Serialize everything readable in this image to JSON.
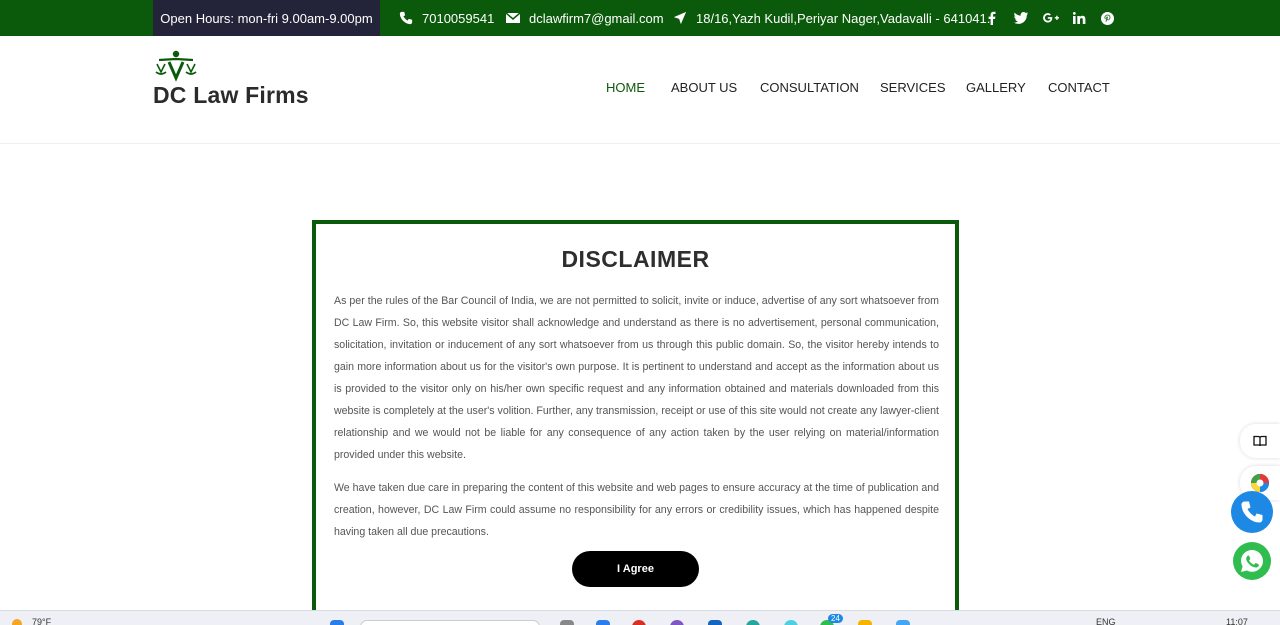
{
  "topbar": {
    "hours": "Open Hours: mon-fri 9.00am-9.00pm",
    "phone": "7010059541",
    "email": "dclawfirm7@gmail.com",
    "address": "18/16,Yazh Kudil,Periyar Nager,Vadavalli - 641041.",
    "social": [
      "f",
      "twitter",
      "G+",
      "in",
      "pinterest"
    ]
  },
  "brand": {
    "name": "DC Law Firms"
  },
  "nav": {
    "items": [
      "HOME",
      "ABOUT US",
      "CONSULTATION",
      "SERVICES",
      "GALLERY",
      "CONTACT"
    ],
    "active": "HOME"
  },
  "disclaimer": {
    "title": "DISCLAIMER",
    "paragraph1": "As per the rules of the Bar Council of India, we are not permitted to solicit, invite or induce, advertise of any sort whatsoever from DC Law Firm. So, this website visitor shall acknowledge and understand as there is no advertisement, personal communication, solicitation, invitation or inducement of any sort whatsoever from us through this public domain. So, the visitor hereby intends to gain more information about us for the visitor's own purpose. It is pertinent to understand and accept as the information about us is provided to the visitor only on his/her own specific request and any information obtained and materials downloaded from this website is completely at the user's volition. Further, any transmission, receipt or use of this site would not create any lawyer-client relationship and we would not be liable for any consequence of any action taken by the user relying on material/information provided under this website.",
    "paragraph2": "We have taken due care in preparing the content of this website and web pages to ensure accuracy at the time of publication and creation, however, DC Law Firm could assume no responsibility for any errors or credibility issues, which has happened despite having taken all due precautions.",
    "agree_label": "I Agree"
  },
  "taskbar": {
    "weather": "79°F",
    "notification_badge": "24",
    "language": "ENG",
    "time": "11:07"
  },
  "colors": {
    "brand_green": "#0b5a0b",
    "hours_bg": "#23233a",
    "button_black": "#000000",
    "phone_blue": "#1e88e5",
    "whatsapp_green": "#2ebd4e"
  }
}
